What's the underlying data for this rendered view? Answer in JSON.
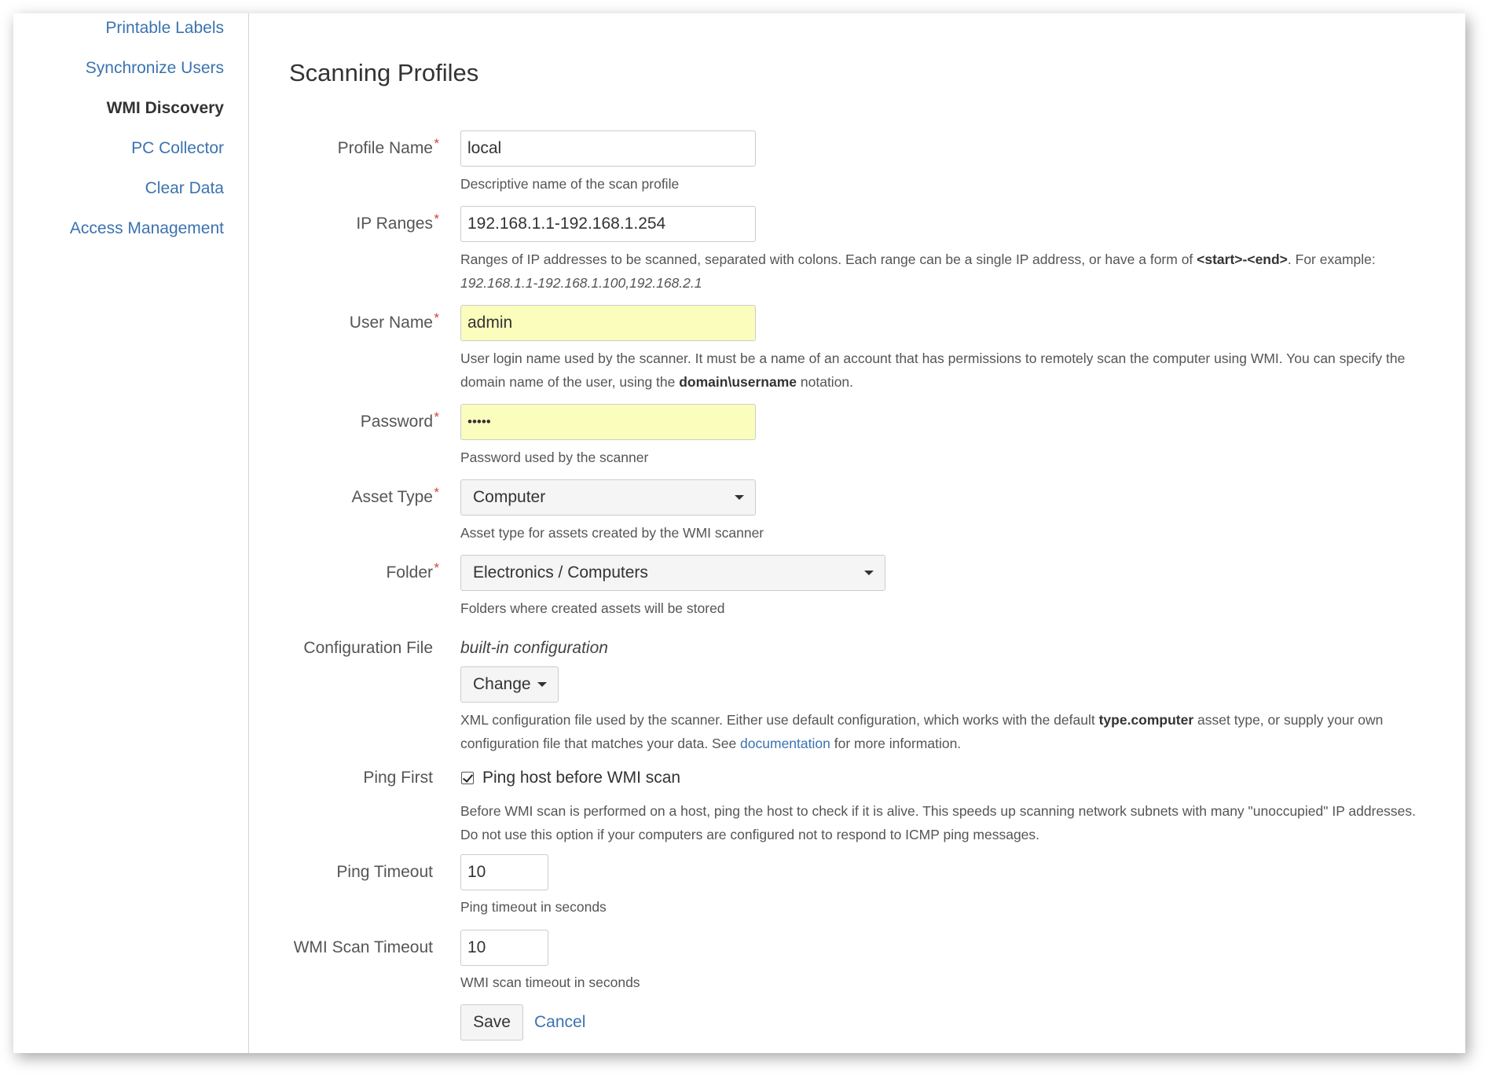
{
  "sidebar": {
    "items": [
      {
        "label": "Printable Labels",
        "active": false
      },
      {
        "label": "Synchronize Users",
        "active": false
      },
      {
        "label": "WMI Discovery",
        "active": true
      },
      {
        "label": "PC Collector",
        "active": false
      },
      {
        "label": "Clear Data",
        "active": false
      },
      {
        "label": "Access Management",
        "active": false
      }
    ]
  },
  "page_title": "Scanning Profiles",
  "form": {
    "profile_name": {
      "label": "Profile Name",
      "value": "local",
      "help": "Descriptive name of the scan profile"
    },
    "ip_ranges": {
      "label": "IP Ranges",
      "value": "192.168.1.1-192.168.1.254",
      "help_pre": "Ranges of IP addresses to be scanned, separated with colons. Each range can be a single IP address, or have a form of ",
      "help_bold": "<start>-<end>",
      "help_post": ". For example:",
      "help_example": "192.168.1.1-192.168.1.100,192.168.2.1"
    },
    "user_name": {
      "label": "User Name",
      "value": "admin",
      "help_line1": "User login name used by the scanner. It must be a name of an account that has permissions to remotely scan the computer using WMI. You can specify the",
      "help_pre": "domain name of the user, using the ",
      "help_bold": "domain\\username",
      "help_post": " notation."
    },
    "password": {
      "label": "Password",
      "value": "•••••",
      "help": "Password used by the scanner"
    },
    "asset_type": {
      "label": "Asset Type",
      "value": "Computer",
      "help": "Asset type for assets created by the WMI scanner"
    },
    "folder": {
      "label": "Folder",
      "value": "Electronics / Computers",
      "help": "Folders where created assets will be stored"
    },
    "configuration_file": {
      "label": "Configuration File",
      "value": "built-in configuration",
      "change_label": "Change",
      "help_pre": "XML configuration file used by the scanner. Either use default configuration, which works with the default ",
      "help_bold": "type.computer",
      "help_post": " asset type, or supply your own",
      "help_line2_pre": "configuration file that matches your data. See ",
      "help_link": "documentation",
      "help_line2_post": " for more information."
    },
    "ping_first": {
      "label": "Ping First",
      "checked": true,
      "checkbox_label": "Ping host before WMI scan",
      "help_line1": "Before WMI scan is performed on a host, ping the host to check if it is alive. This speeds up scanning network subnets with many \"unoccupied\" IP addresses.",
      "help_line2": "Do not use this option if your computers are configured not to respond to ICMP ping messages."
    },
    "ping_timeout": {
      "label": "Ping Timeout",
      "value": "10",
      "help": "Ping timeout in seconds"
    },
    "wmi_scan_timeout": {
      "label": "WMI Scan Timeout",
      "value": "10",
      "help": "WMI scan timeout in seconds"
    },
    "required_marker": "*",
    "save_label": "Save",
    "cancel_label": "Cancel"
  },
  "colors": {
    "link": "#3b73af",
    "required": "#d04437",
    "autofill": "#fbfdbd"
  }
}
